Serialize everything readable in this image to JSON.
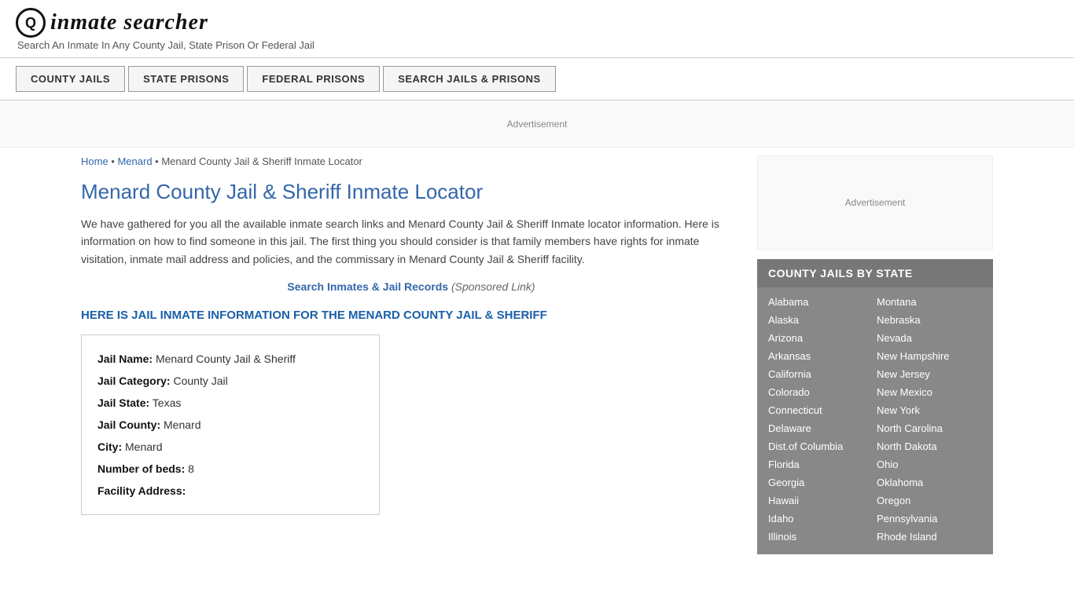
{
  "header": {
    "logo_icon": "🔍",
    "logo_text": "inmate searcher",
    "tagline": "Search An Inmate In Any County Jail, State Prison Or Federal Jail"
  },
  "nav": {
    "buttons": [
      {
        "label": "COUNTY JAILS",
        "name": "county-jails-btn"
      },
      {
        "label": "STATE PRISONS",
        "name": "state-prisons-btn"
      },
      {
        "label": "FEDERAL PRISONS",
        "name": "federal-prisons-btn"
      },
      {
        "label": "SEARCH JAILS & PRISONS",
        "name": "search-jails-btn"
      }
    ]
  },
  "ad": {
    "banner_label": "Advertisement",
    "sidebar_label": "Advertisement"
  },
  "breadcrumb": {
    "home": "Home",
    "menard": "Menard",
    "current": "Menard County Jail & Sheriff Inmate Locator"
  },
  "page_title": "Menard County Jail & Sheriff Inmate Locator",
  "intro_text": "We have gathered for you all the available inmate search links and Menard County Jail & Sheriff Inmate locator information. Here is information on how to find someone in this jail. The first thing you should consider is that family members have rights for inmate visitation, inmate mail address and policies, and the commissary in Menard County Jail & Sheriff facility.",
  "search_link": {
    "text": "Search Inmates & Jail Records",
    "sponsored": "(Sponsored Link)"
  },
  "info_header": "HERE IS JAIL INMATE INFORMATION FOR THE MENARD COUNTY JAIL & SHERIFF",
  "jail_info": {
    "jail_name_label": "Jail Name:",
    "jail_name_value": "Menard County Jail & Sheriff",
    "jail_category_label": "Jail Category:",
    "jail_category_value": "County Jail",
    "jail_state_label": "Jail State:",
    "jail_state_value": "Texas",
    "jail_county_label": "Jail County:",
    "jail_county_value": "Menard",
    "city_label": "City:",
    "city_value": "Menard",
    "beds_label": "Number of beds:",
    "beds_value": "8",
    "facility_address_label": "Facility Address:"
  },
  "state_box": {
    "title": "COUNTY JAILS BY STATE",
    "states_col1": [
      "Alabama",
      "Alaska",
      "Arizona",
      "Arkansas",
      "California",
      "Colorado",
      "Connecticut",
      "Delaware",
      "Dist.of Columbia",
      "Florida",
      "Georgia",
      "Hawaii",
      "Idaho",
      "Illinois"
    ],
    "states_col2": [
      "Montana",
      "Nebraska",
      "Nevada",
      "New Hampshire",
      "New Jersey",
      "New Mexico",
      "New York",
      "North Carolina",
      "North Dakota",
      "Ohio",
      "Oklahoma",
      "Oregon",
      "Pennsylvania",
      "Rhode Island"
    ]
  }
}
